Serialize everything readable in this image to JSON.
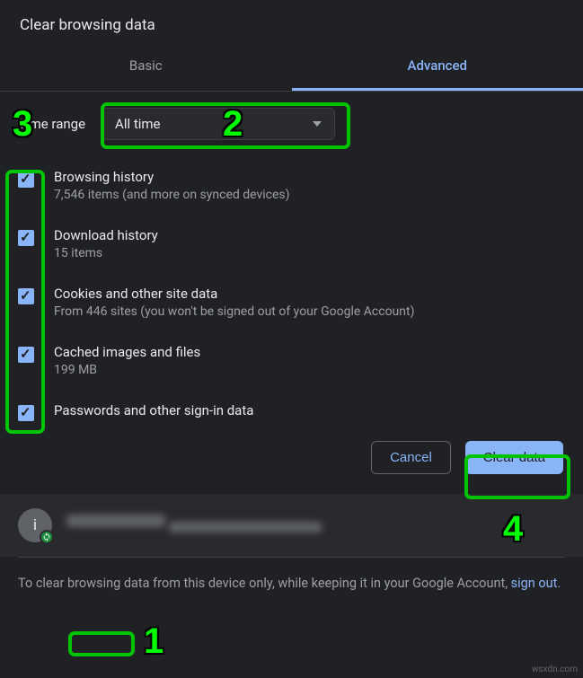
{
  "dialog": {
    "title": "Clear browsing data"
  },
  "tabs": {
    "basic": "Basic",
    "advanced": "Advanced"
  },
  "time_range": {
    "label": "Time range",
    "selected": "All time"
  },
  "options": {
    "browsing_history": {
      "title": "Browsing history",
      "sub": "7,546 items (and more on synced devices)"
    },
    "download_history": {
      "title": "Download history",
      "sub": "15 items"
    },
    "cookies": {
      "title": "Cookies and other site data",
      "sub": "From 446 sites (you won't be signed out of your Google Account)"
    },
    "cache": {
      "title": "Cached images and files",
      "sub": "199 MB"
    },
    "passwords": {
      "title": "Passwords and other sign-in data",
      "sub": ""
    }
  },
  "buttons": {
    "cancel": "Cancel",
    "clear": "Clear data"
  },
  "account": {
    "initial": "i"
  },
  "footer": {
    "pre": "To clear browsing data from this device only, while keeping it in your Google Account, ",
    "link": "sign out",
    "post": "."
  },
  "annotations": {
    "n1": "1",
    "n2": "2",
    "n3": "3",
    "n4": "4"
  },
  "watermark": "wsxdn.com"
}
